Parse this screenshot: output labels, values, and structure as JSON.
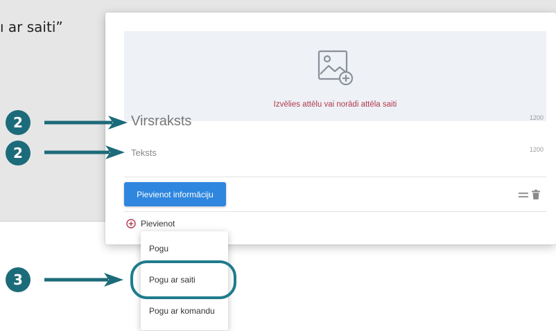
{
  "background_text": "ı ar saiti”",
  "card": {
    "image_hint": "Izvēlies attēlu vai norādi attēla saiti",
    "title_placeholder": "Virsraksts",
    "title_counter": "1200",
    "text_placeholder": "Teksts",
    "text_counter": "1200",
    "add_info_button": "Pievienot informāciju",
    "add_label": "Pievienot"
  },
  "dropdown": {
    "items": [
      "Pogu",
      "Pogu ar saiti",
      "Pogu ar komandu"
    ]
  },
  "badges": [
    "2",
    "2",
    "3"
  ],
  "colors": {
    "badge": "#1c6b7a",
    "primary_button": "#2e86de",
    "image_hint": "#b03a4e",
    "highlight": "#1f7c8c"
  },
  "icons": [
    "add-image-icon",
    "drag-handle-icon",
    "trash-icon",
    "plus-circle-icon",
    "arrow-icon"
  ]
}
